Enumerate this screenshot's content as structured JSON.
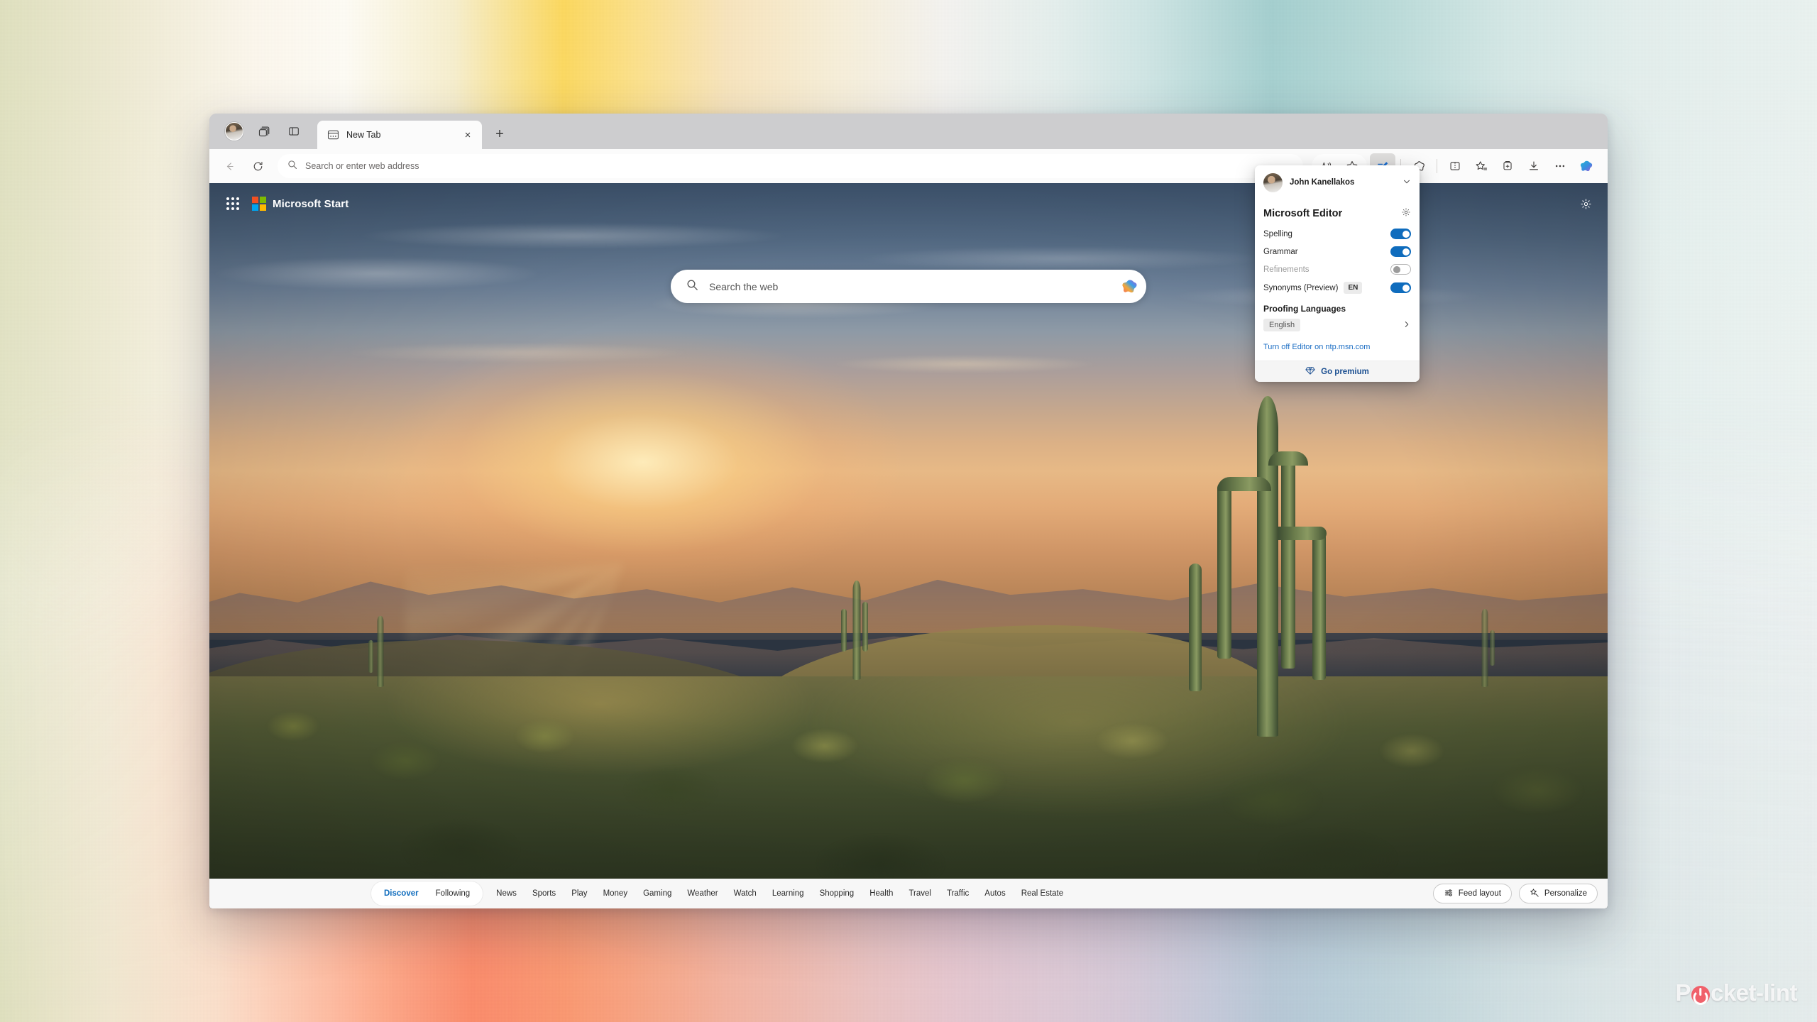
{
  "desktop": {
    "watermark": {
      "prefix": "P",
      "icon": "power-button-icon",
      "suffix": "cket-lint"
    },
    "gradient_colors": [
      "#dfe0bf",
      "#fbf6ec",
      "#fbd85f",
      "#cfe5e4",
      "#a5cfcf",
      "#fa8364",
      "#d6aabe",
      "#c4c4de"
    ]
  },
  "browser": {
    "tabstrip": {
      "profile_icon": "profile-avatar-icon",
      "workspaces_icon": "workspaces-icon",
      "tab_actions_icon": "tab-actions-menu-icon",
      "tabs": [
        {
          "title": "New Tab",
          "favicon": "new-tab-page-icon",
          "close_label": "×",
          "active": true
        }
      ],
      "new_tab_label": "+"
    },
    "navbar": {
      "back_icon": "back-arrow-icon",
      "refresh_icon": "refresh-icon",
      "address_placeholder": "Search or enter web address",
      "address_value": "",
      "search_icon": "search-icon",
      "right_icons": [
        {
          "name": "read-aloud-icon",
          "label": "A"
        },
        {
          "name": "favorites-star-icon",
          "label": ""
        },
        {
          "name": "editor-pen-icon",
          "label": "",
          "active": true
        },
        {
          "name": "copilot-mode-icon",
          "label": ""
        },
        {
          "name": "split-screen-icon",
          "label": ""
        },
        {
          "name": "favorites-list-icon",
          "label": ""
        },
        {
          "name": "collections-icon",
          "label": ""
        },
        {
          "name": "downloads-icon",
          "label": ""
        },
        {
          "name": "settings-and-more-icon",
          "label": "···"
        },
        {
          "name": "copilot-sidebar-icon",
          "label": ""
        }
      ]
    }
  },
  "newtab": {
    "header": {
      "app_grid_icon": "app-grid-icon",
      "logo_icon": "microsoft-logo-icon",
      "brand": "Microsoft Start",
      "settings_icon": "page-settings-gear-icon"
    },
    "search": {
      "placeholder": "Search the web",
      "value": "",
      "search_icon": "search-icon",
      "copilot_icon": "copilot-icon"
    },
    "feed_nav": {
      "primary": [
        {
          "label": "Discover",
          "active": true
        },
        {
          "label": "Following",
          "active": false
        }
      ],
      "categories": [
        "News",
        "Sports",
        "Play",
        "Money",
        "Gaming",
        "Weather",
        "Watch",
        "Learning",
        "Shopping",
        "Health",
        "Travel",
        "Traffic",
        "Autos",
        "Real Estate"
      ],
      "actions": [
        {
          "label": "Feed layout",
          "icon": "sliders-icon"
        },
        {
          "label": "Personalize",
          "icon": "magic-wand-star-icon"
        }
      ]
    },
    "wallpaper_alt": "Desert sunset with saguaro cacti and mountains"
  },
  "editor_flyout": {
    "account": {
      "name": "John Kanellakos",
      "email_redacted": true,
      "avatar_icon": "profile-avatar-icon",
      "chevron_icon": "chevron-down-icon"
    },
    "title": "Microsoft Editor",
    "settings_icon": "gear-icon",
    "settings": [
      {
        "label": "Spelling",
        "state": "on",
        "disabled": false,
        "badge": ""
      },
      {
        "label": "Grammar",
        "state": "on",
        "disabled": false,
        "badge": ""
      },
      {
        "label": "Refinements",
        "state": "off",
        "disabled": true,
        "badge": ""
      },
      {
        "label": "Synonyms (Preview)",
        "state": "on",
        "disabled": false,
        "badge": "EN"
      }
    ],
    "proofing": {
      "heading": "Proofing Languages",
      "language": "English",
      "arrow_icon": "chevron-right-icon"
    },
    "turn_off_link": "Turn off Editor on ntp.msn.com",
    "premium": {
      "label": "Go premium",
      "icon": "diamond-icon"
    },
    "accent_color": "#0f6cbd",
    "link_color": "#1c6ec4"
  }
}
